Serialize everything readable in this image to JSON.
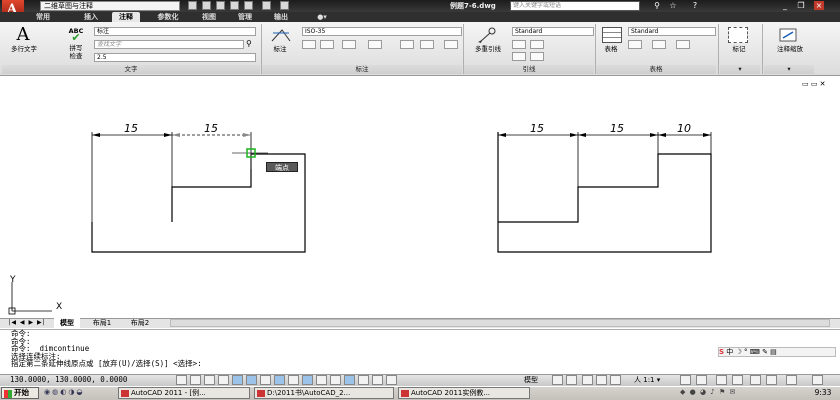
{
  "title_bar": {
    "workspace": "二维草图与注释",
    "file_title": "例题7-6.dwg",
    "search_placeholder": "键入关键字或短语"
  },
  "ribbon_tabs": [
    "常用",
    "插入",
    "注释",
    "参数化",
    "视图",
    "管理",
    "输出"
  ],
  "ribbon": {
    "text_panel": {
      "mtext": "多行文字",
      "spell_abc": "ABC",
      "spell_label_1": "拼写",
      "spell_label_2": "检查",
      "style_combo": "标注",
      "find_placeholder": "查找文字",
      "height_combo": "2.5",
      "panel_label": "文字"
    },
    "dim_panel": {
      "dim_button": "标注",
      "dim_style": "ISO-35",
      "panel_label": "标注"
    },
    "leader_panel": {
      "multileader": "多重引线",
      "leader_style": "Standard",
      "panel_label": "引线"
    },
    "table_panel": {
      "table_button": "表格",
      "table_style": "Standard",
      "panel_label": "表格"
    },
    "markup_panel": {
      "label": "标记"
    },
    "scale_panel": {
      "label": "注释缩放"
    }
  },
  "drawing": {
    "left_dims": [
      "15",
      "15"
    ],
    "right_dims": [
      "15",
      "15",
      "10"
    ],
    "snap_tooltip": "端点",
    "ucs_y": "Y",
    "ucs_x": "X"
  },
  "layout_tabs": [
    "模型",
    "布局1",
    "布局2"
  ],
  "command_history": [
    "命令:",
    "命令:",
    "命令: _dimcontinue",
    "选择连续标注:",
    "指定第二条延伸线原点或 [放弃(U)/选择(S)] <选择>:"
  ],
  "status_bar": {
    "coordinates": "130.0000, 130.0000, 0.0000",
    "model_label": "模型",
    "scale": "1:1"
  },
  "taskbar": {
    "start_label": "开始",
    "windows": [
      "AutoCAD 2011 - [例...",
      "D:\\2011书\\AutoCAD_2...",
      "AutoCAD 2011实例教..."
    ],
    "clock": "9:33",
    "ime_label": "中"
  }
}
